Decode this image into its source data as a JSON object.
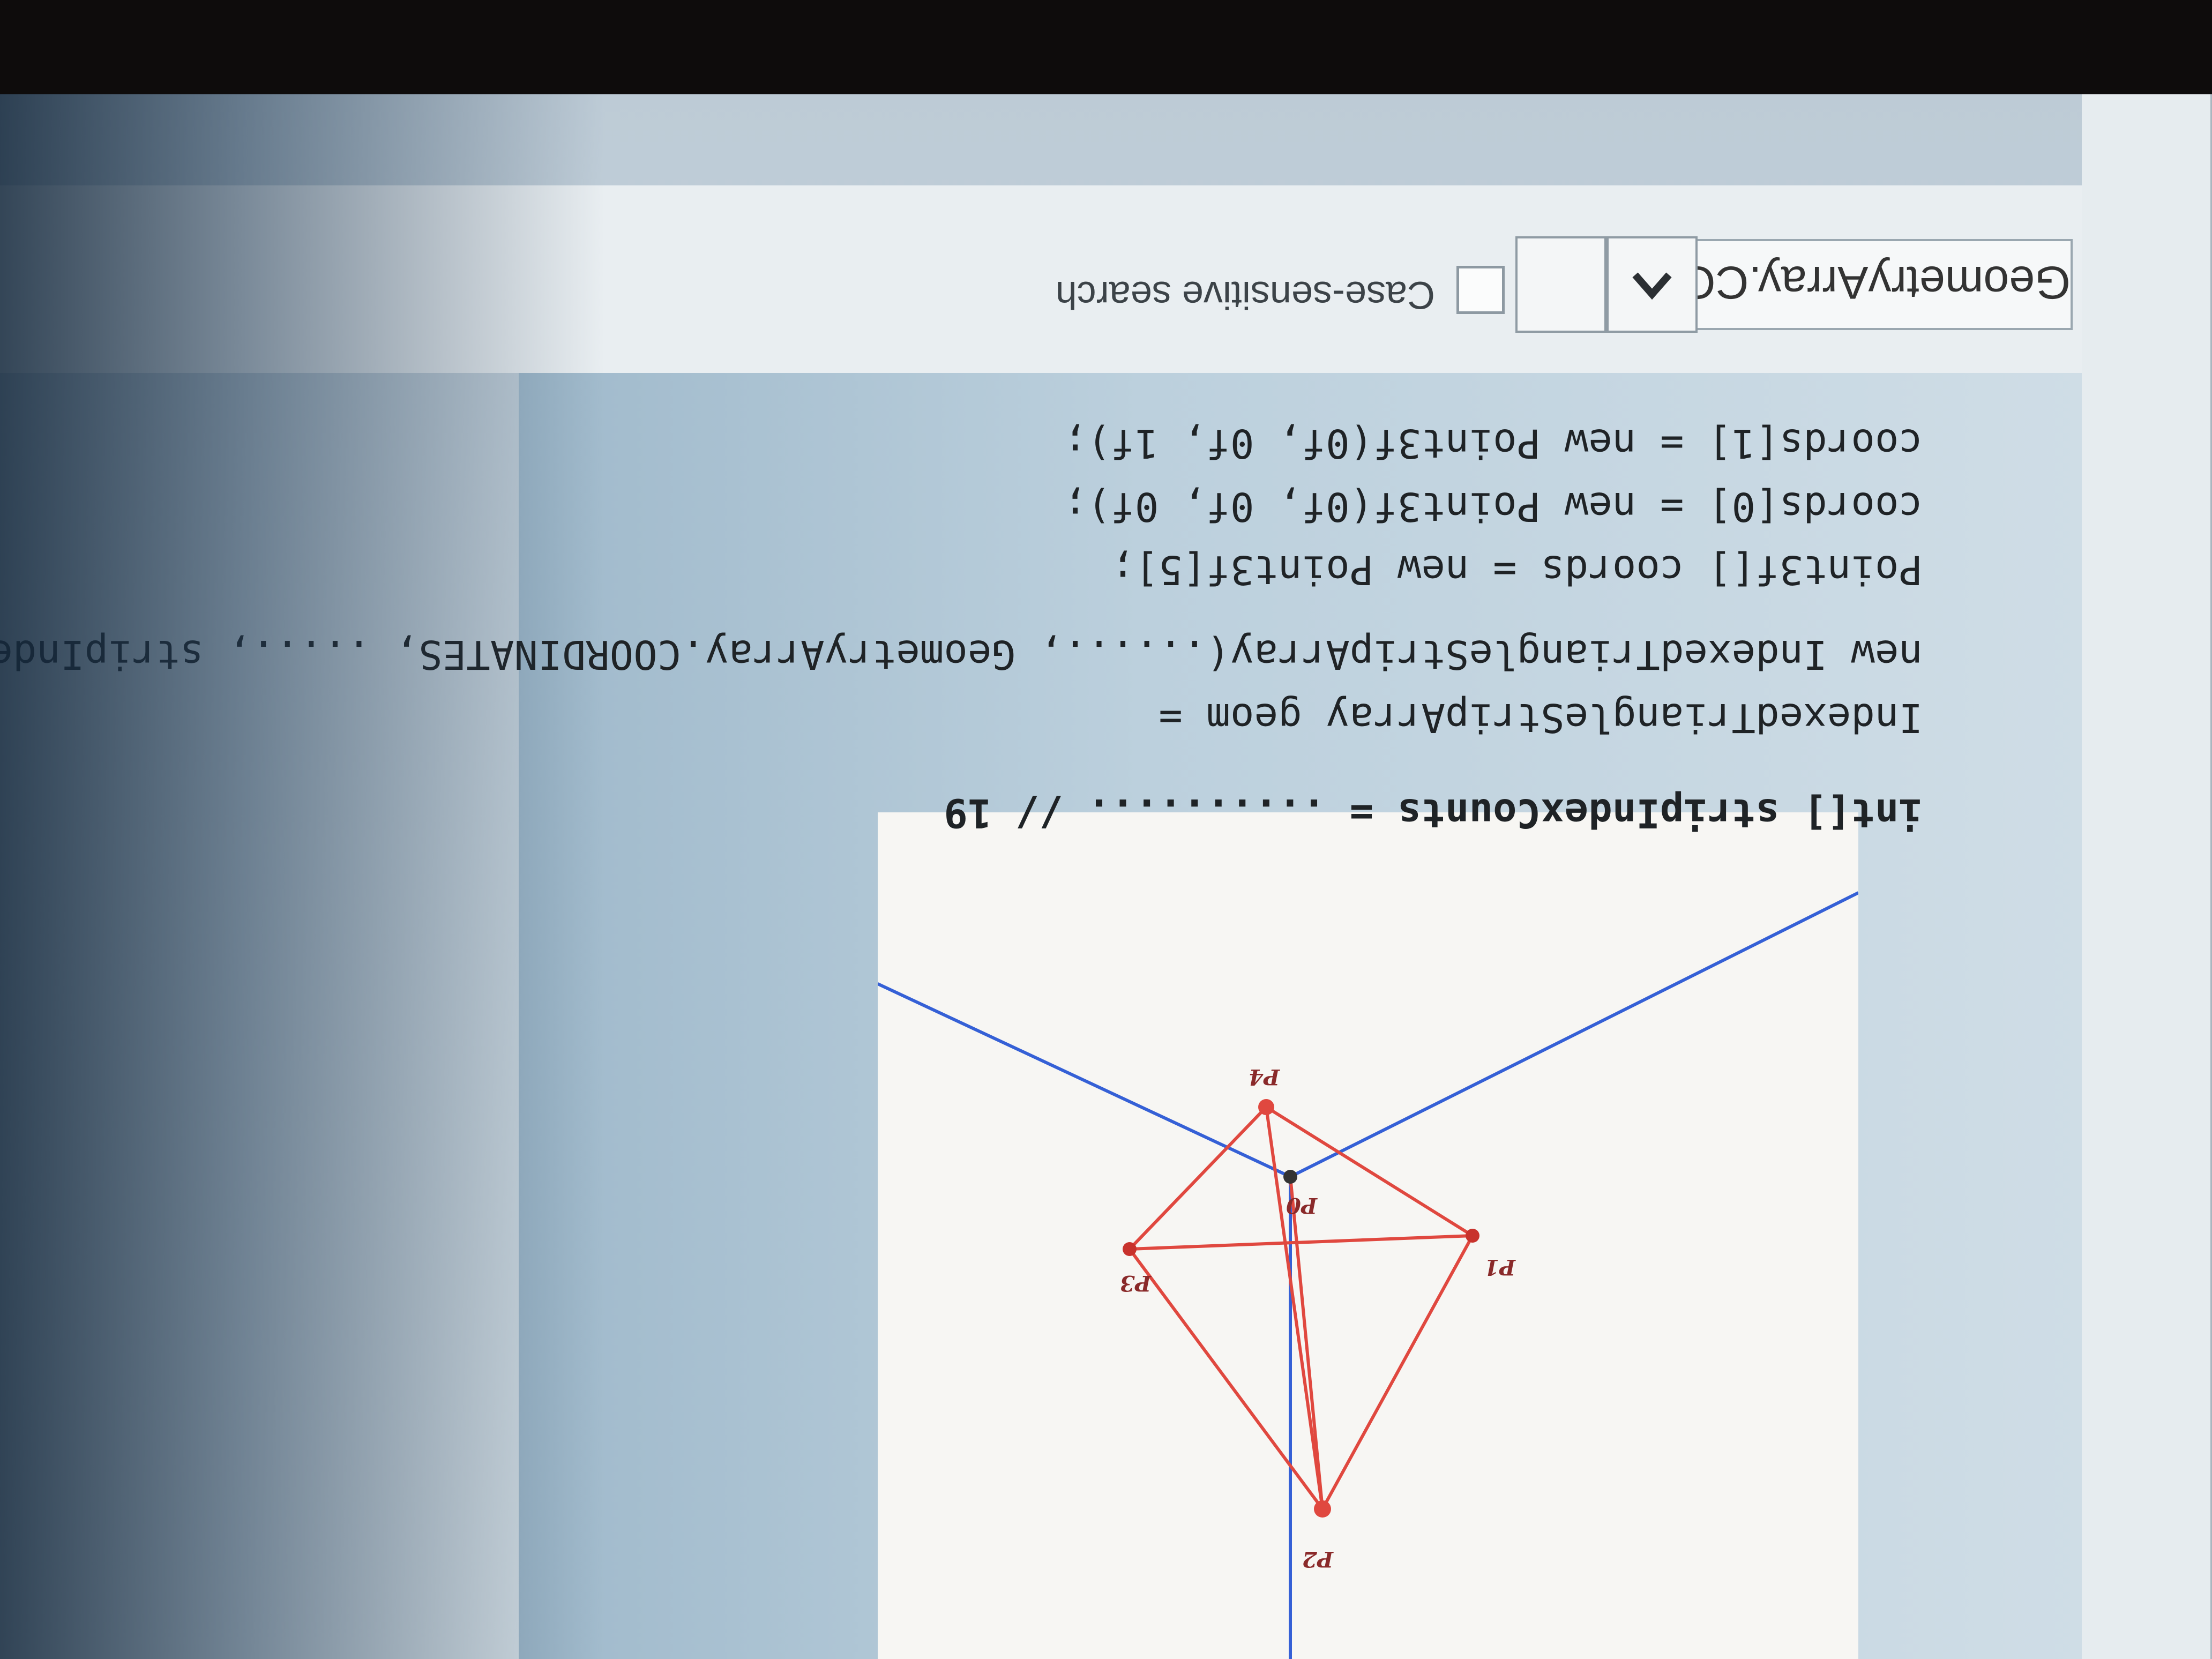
{
  "findbar": {
    "search_value": "GeometryArray.COORDINATES",
    "prev_label": "previous match",
    "next_label": "next match",
    "case_sensitive_label": "Case-sensitive search",
    "case_sensitive_checked": false
  },
  "code": {
    "lines": [
      "int[] stripIndexCounts = .......... // 19",
      "IndexedTriangleStripArray geom =",
      "new IndexedTriangleStripArray(......, GeometryArray.COORDINATES, ....., stripIndexCounts);",
      "Point3f[] coords = new Point3f[5];",
      "coords[0] = new Point3f(0f, 0f, 0f);",
      "coords[1] = new Point3f(0f, 0f, 1f);"
    ]
  },
  "figure": {
    "vertex_labels": [
      "P0",
      "P1",
      "P2",
      "P3",
      "P4"
    ],
    "edge_color": "#e0483f",
    "axis_color": "#3560d6"
  }
}
